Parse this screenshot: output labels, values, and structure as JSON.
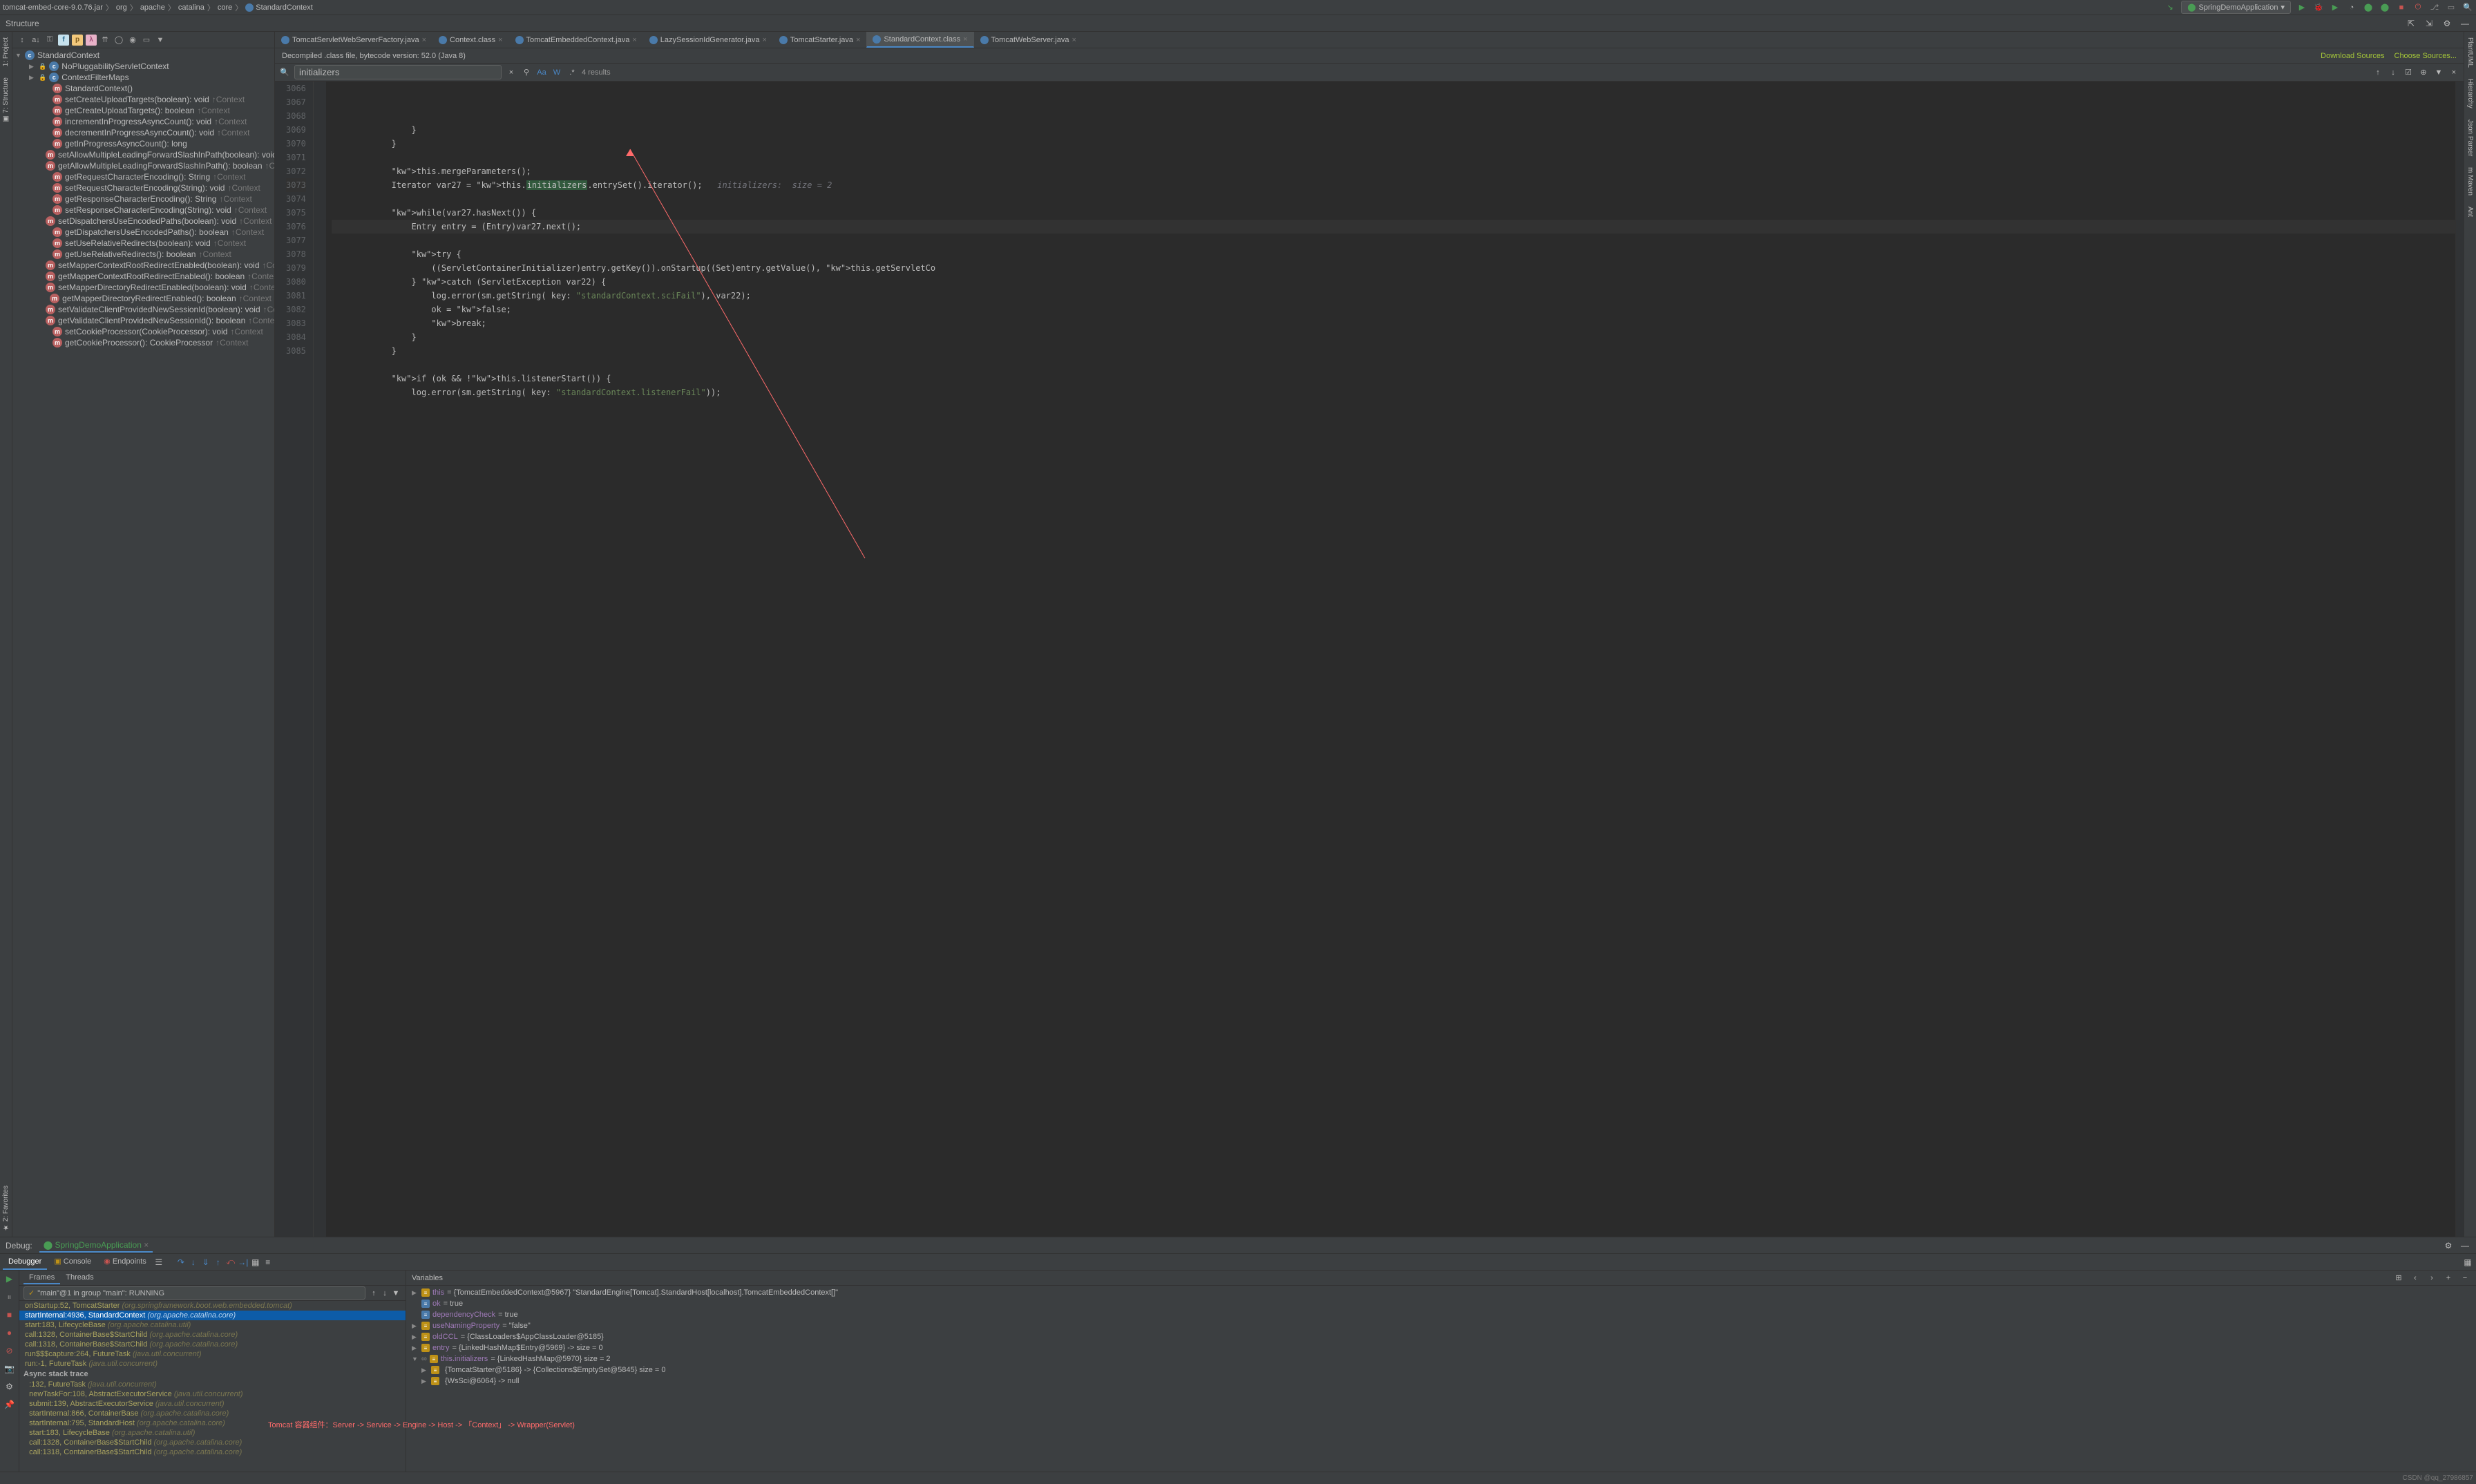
{
  "breadcrumb": [
    "tomcat-embed-core-9.0.76.jar",
    "org",
    "apache",
    "catalina",
    "core",
    "StandardContext"
  ],
  "runConfig": "SpringDemoApplication",
  "structure": {
    "title": "Structure",
    "root": "StandardContext",
    "children": [
      {
        "icon": "class",
        "label": "NoPluggabilityServletContext",
        "type": ""
      },
      {
        "icon": "class",
        "label": "ContextFilterMaps",
        "type": ""
      },
      {
        "icon": "method",
        "label": "StandardContext()",
        "type": ""
      },
      {
        "icon": "method",
        "label": "setCreateUploadTargets(boolean): void",
        "inherit": "↑Context"
      },
      {
        "icon": "method",
        "label": "getCreateUploadTargets(): boolean",
        "inherit": "↑Context"
      },
      {
        "icon": "method",
        "label": "incrementInProgressAsyncCount(): void",
        "inherit": "↑Context"
      },
      {
        "icon": "method",
        "label": "decrementInProgressAsyncCount(): void",
        "inherit": "↑Context"
      },
      {
        "icon": "method",
        "label": "getInProgressAsyncCount(): long",
        "inherit": ""
      },
      {
        "icon": "method",
        "label": "setAllowMultipleLeadingForwardSlashInPath(boolean): void",
        "inherit": "↑Context"
      },
      {
        "icon": "method",
        "label": "getAllowMultipleLeadingForwardSlashInPath(): boolean",
        "inherit": "↑Context"
      },
      {
        "icon": "method",
        "label": "getRequestCharacterEncoding(): String",
        "inherit": "↑Context"
      },
      {
        "icon": "method",
        "label": "setRequestCharacterEncoding(String): void",
        "inherit": "↑Context"
      },
      {
        "icon": "method",
        "label": "getResponseCharacterEncoding(): String",
        "inherit": "↑Context"
      },
      {
        "icon": "method",
        "label": "setResponseCharacterEncoding(String): void",
        "inherit": "↑Context"
      },
      {
        "icon": "method",
        "label": "setDispatchersUseEncodedPaths(boolean): void",
        "inherit": "↑Context"
      },
      {
        "icon": "method",
        "label": "getDispatchersUseEncodedPaths(): boolean",
        "inherit": "↑Context"
      },
      {
        "icon": "method",
        "label": "setUseRelativeRedirects(boolean): void",
        "inherit": "↑Context"
      },
      {
        "icon": "method",
        "label": "getUseRelativeRedirects(): boolean",
        "inherit": "↑Context"
      },
      {
        "icon": "method",
        "label": "setMapperContextRootRedirectEnabled(boolean): void",
        "inherit": "↑Context"
      },
      {
        "icon": "method",
        "label": "getMapperContextRootRedirectEnabled(): boolean",
        "inherit": "↑Context"
      },
      {
        "icon": "method",
        "label": "setMapperDirectoryRedirectEnabled(boolean): void",
        "inherit": "↑Context"
      },
      {
        "icon": "method",
        "label": "getMapperDirectoryRedirectEnabled(): boolean",
        "inherit": "↑Context"
      },
      {
        "icon": "method",
        "label": "setValidateClientProvidedNewSessionId(boolean): void",
        "inherit": "↑Context"
      },
      {
        "icon": "method",
        "label": "getValidateClientProvidedNewSessionId(): boolean",
        "inherit": "↑Context"
      },
      {
        "icon": "method",
        "label": "setCookieProcessor(CookieProcessor): void",
        "inherit": "↑Context"
      },
      {
        "icon": "method",
        "label": "getCookieProcessor(): CookieProcessor",
        "inherit": "↑Context"
      }
    ]
  },
  "editorTabs": [
    {
      "label": "TomcatServletWebServerFactory.java",
      "active": false
    },
    {
      "label": "Context.class",
      "active": false
    },
    {
      "label": "TomcatEmbeddedContext.java",
      "active": false
    },
    {
      "label": "LazySessionIdGenerator.java",
      "active": false
    },
    {
      "label": "TomcatStarter.java",
      "active": false
    },
    {
      "label": "StandardContext.class",
      "active": true
    },
    {
      "label": "TomcatWebServer.java",
      "active": false
    }
  ],
  "banner": {
    "text": "Decompiled .class file, bytecode version: 52.0 (Java 8)",
    "downloadSources": "Download Sources",
    "chooseSources": "Choose Sources..."
  },
  "search": {
    "query": "initializers",
    "results": "4 results"
  },
  "code": {
    "startLine": 3066,
    "currentLine": 3073,
    "lines": [
      "                }",
      "            }",
      "",
      "            this.mergeParameters();",
      "            Iterator var27 = this.initializers.entrySet().iterator();   initializers:  size = 2",
      "",
      "            while(var27.hasNext()) {",
      "                Entry entry = (Entry)var27.next();",
      "",
      "                try {",
      "                    ((ServletContainerInitializer)entry.getKey()).onStartup((Set)entry.getValue(), this.getServletCo",
      "                } catch (ServletException var22) {",
      "                    log.error(sm.getString( key: \"standardContext.sciFail\"), var22);",
      "                    ok = false;",
      "                    break;",
      "                }",
      "            }",
      "",
      "            if (ok && !this.listenerStart()) {",
      "                log.error(sm.getString( key: \"standardContext.listenerFail\"));"
    ]
  },
  "debug": {
    "title": "Debug:",
    "app": "SpringDemoApplication",
    "subtabs": [
      "Debugger",
      "Console",
      "Endpoints"
    ],
    "framesTabs": [
      "Frames",
      "Threads"
    ],
    "thread": "\"main\"@1 in group \"main\": RUNNING",
    "frames": [
      {
        "label": "onStartup:52, TomcatStarter",
        "pkg": "(org.springframework.boot.web.embedded.tomcat)",
        "style": "yellow"
      },
      {
        "label": "startInternal:4936, StandardContext",
        "pkg": "(org.apache.catalina.core)",
        "style": "selected"
      },
      {
        "label": "start:183, LifecycleBase",
        "pkg": "(org.apache.catalina.util)",
        "style": "yellow"
      },
      {
        "label": "call:1328, ContainerBase$StartChild",
        "pkg": "(org.apache.catalina.core)",
        "style": "yellow"
      },
      {
        "label": "call:1318, ContainerBase$StartChild",
        "pkg": "(org.apache.catalina.core)",
        "style": "yellow"
      },
      {
        "label": "run$$$capture:264, FutureTask",
        "pkg": "(java.util.concurrent)",
        "style": "yellow"
      },
      {
        "label": "run:-1, FutureTask",
        "pkg": "(java.util.concurrent)",
        "style": "yellow"
      }
    ],
    "asyncLabel": "Async stack trace",
    "asyncFrames": [
      {
        "label": "<init>:132, FutureTask",
        "pkg": "(java.util.concurrent)"
      },
      {
        "label": "newTaskFor:108, AbstractExecutorService",
        "pkg": "(java.util.concurrent)"
      },
      {
        "label": "submit:139, AbstractExecutorService",
        "pkg": "(java.util.concurrent)"
      },
      {
        "label": "startInternal:866, ContainerBase",
        "pkg": "(org.apache.catalina.core)"
      },
      {
        "label": "startInternal:795, StandardHost",
        "pkg": "(org.apache.catalina.core)"
      },
      {
        "label": "start:183, LifecycleBase",
        "pkg": "(org.apache.catalina.util)"
      },
      {
        "label": "call:1328, ContainerBase$StartChild",
        "pkg": "(org.apache.catalina.core)"
      },
      {
        "label": "call:1318, ContainerBase$StartChild",
        "pkg": "(org.apache.catalina.core)"
      }
    ],
    "varsTitle": "Variables",
    "vars": [
      {
        "indent": 0,
        "arrow": "▶",
        "icon": "obj",
        "name": "this",
        "val": "= {TomcatEmbeddedContext@5967} \"StandardEngine[Tomcat].StandardHost[localhost].TomcatEmbeddedContext[]\""
      },
      {
        "indent": 0,
        "arrow": "",
        "icon": "bool",
        "name": "ok",
        "val": "= true"
      },
      {
        "indent": 0,
        "arrow": "",
        "icon": "bool",
        "name": "dependencyCheck",
        "val": "= true"
      },
      {
        "indent": 0,
        "arrow": "▶",
        "icon": "obj",
        "name": "useNamingProperty",
        "val": "= \"false\""
      },
      {
        "indent": 0,
        "arrow": "▶",
        "icon": "obj",
        "name": "oldCCL",
        "val": "= {ClassLoaders$AppClassLoader@5185}"
      },
      {
        "indent": 0,
        "arrow": "▶",
        "icon": "obj",
        "name": "entry",
        "val": "= {LinkedHashMap$Entry@5969}  -> size = 0"
      },
      {
        "indent": 0,
        "arrow": "▼",
        "icon": "obj",
        "name": "this.initializers",
        "val": "= {LinkedHashMap@5970}  size = 2",
        "watch": true
      },
      {
        "indent": 1,
        "arrow": "▶",
        "icon": "obj",
        "name": "",
        "val": "{TomcatStarter@5186}  -> {Collections$EmptySet@5845}  size = 0",
        "plain": true
      },
      {
        "indent": 1,
        "arrow": "▶",
        "icon": "obj",
        "name": "",
        "val": "{WsSci@6064}  -> null",
        "plain": true
      }
    ],
    "annotation": "Tomcat 容器组件：Server -> Service -> Engine -> Host -> 「Context」 -> Wrapper(Servlet)"
  },
  "watermark": "CSDN @qq_27986857"
}
